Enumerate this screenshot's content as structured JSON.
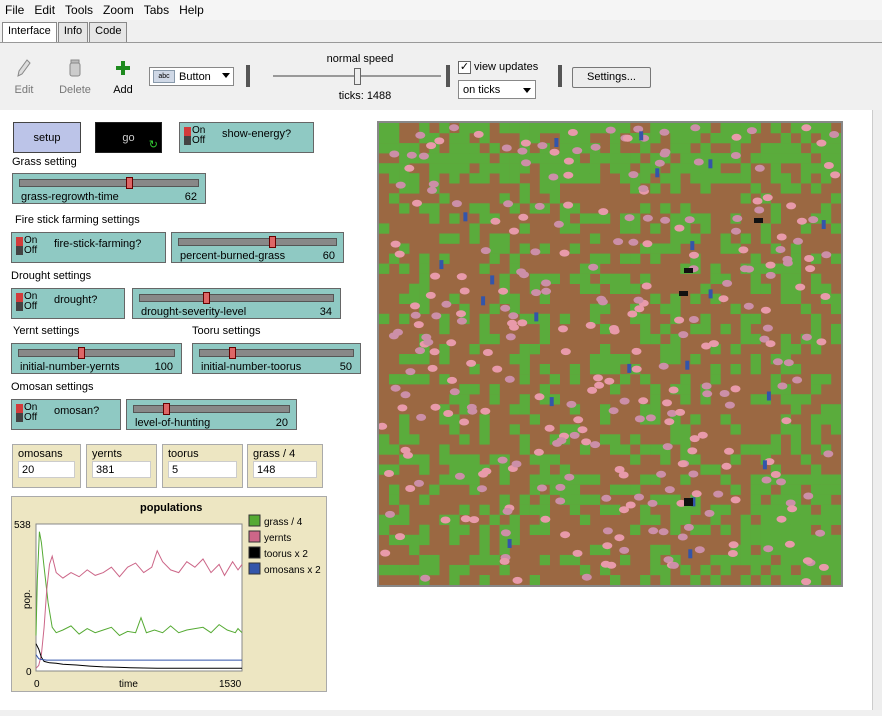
{
  "menu": [
    "File",
    "Edit",
    "Tools",
    "Zoom",
    "Tabs",
    "Help"
  ],
  "tabs": [
    {
      "label": "Interface",
      "active": true
    },
    {
      "label": "Info",
      "active": false
    },
    {
      "label": "Code",
      "active": false
    }
  ],
  "toolbar": {
    "edit_label": "Edit",
    "delete_label": "Delete",
    "add_label": "Add",
    "widget_type": "Button",
    "speed_label": "normal speed",
    "speed_fraction": 0.5,
    "ticks_text": "ticks: 1488",
    "view_updates_label": "view updates",
    "view_updates_checked": true,
    "update_mode": "on ticks",
    "settings_label": "Settings..."
  },
  "buttons": {
    "setup": "setup",
    "go": "go"
  },
  "switches": {
    "show_energy": {
      "name": "show-energy?",
      "on": "On",
      "off": "Off"
    },
    "fire_stick": {
      "name": "fire-stick-farming?",
      "on": "On",
      "off": "Off"
    },
    "drought": {
      "name": "drought?",
      "on": "On",
      "off": "Off"
    },
    "omosan": {
      "name": "omosan?",
      "on": "On",
      "off": "Off"
    }
  },
  "labels": {
    "grass": "Grass setting",
    "fire": "Fire stick farming settings",
    "drought": "Drought settings",
    "yernt": "Yernt settings",
    "tooru": "Tooru settings",
    "omosan": "Omosan settings"
  },
  "sliders": {
    "grass_regrowth": {
      "name": "grass-regrowth-time",
      "value": "62",
      "fraction": 0.62
    },
    "percent_burned": {
      "name": "percent-burned-grass",
      "value": "60",
      "fraction": 0.6
    },
    "drought_severity": {
      "name": "drought-severity-level",
      "value": "34",
      "fraction": 0.34
    },
    "initial_yernts": {
      "name": "initial-number-yernts",
      "value": "100",
      "fraction": 0.4
    },
    "initial_toorus": {
      "name": "initial-number-toorus",
      "value": "50",
      "fraction": 0.2
    },
    "level_hunting": {
      "name": "level-of-hunting",
      "value": "20",
      "fraction": 0.2
    }
  },
  "monitors": [
    {
      "name": "omosans",
      "value": "20"
    },
    {
      "name": "yernts",
      "value": "381"
    },
    {
      "name": "toorus",
      "value": "5"
    },
    {
      "name": "grass / 4",
      "value": "148"
    }
  ],
  "chart_data": {
    "type": "line",
    "title": "populations",
    "xlabel": "time",
    "ylabel": "pop.",
    "xlim": [
      0,
      1530
    ],
    "ylim": [
      0,
      538
    ],
    "x_tick_labels": [
      "0",
      "1530"
    ],
    "y_tick_labels": [
      "0",
      "538"
    ],
    "legend_position": "right",
    "series": [
      {
        "name": "grass / 4",
        "color": "#55aa33",
        "points": [
          [
            0,
            130
          ],
          [
            10,
            330
          ],
          [
            25,
            510
          ],
          [
            40,
            470
          ],
          [
            60,
            380
          ],
          [
            90,
            250
          ],
          [
            120,
            160
          ],
          [
            150,
            140
          ],
          [
            200,
            150
          ],
          [
            260,
            165
          ],
          [
            320,
            135
          ],
          [
            380,
            155
          ],
          [
            440,
            140
          ],
          [
            500,
            150
          ],
          [
            560,
            160
          ],
          [
            620,
            130
          ],
          [
            680,
            145
          ],
          [
            740,
            140
          ],
          [
            780,
            195
          ],
          [
            820,
            140
          ],
          [
            880,
            150
          ],
          [
            940,
            140
          ],
          [
            1000,
            165
          ],
          [
            1060,
            140
          ],
          [
            1120,
            150
          ],
          [
            1180,
            155
          ],
          [
            1240,
            160
          ],
          [
            1300,
            140
          ],
          [
            1360,
            170
          ],
          [
            1420,
            150
          ],
          [
            1480,
            140
          ],
          [
            1500,
            155
          ],
          [
            1530,
            140
          ]
        ]
      },
      {
        "name": "yernts",
        "color": "#cc6688",
        "points": [
          [
            0,
            10
          ],
          [
            20,
            20
          ],
          [
            40,
            60
          ],
          [
            60,
            160
          ],
          [
            80,
            300
          ],
          [
            100,
            390
          ],
          [
            120,
            420
          ],
          [
            150,
            360
          ],
          [
            200,
            340
          ],
          [
            260,
            360
          ],
          [
            320,
            345
          ],
          [
            380,
            370
          ],
          [
            440,
            350
          ],
          [
            500,
            360
          ],
          [
            560,
            380
          ],
          [
            620,
            345
          ],
          [
            680,
            380
          ],
          [
            740,
            395
          ],
          [
            800,
            360
          ],
          [
            860,
            380
          ],
          [
            900,
            440
          ],
          [
            940,
            400
          ],
          [
            1000,
            370
          ],
          [
            1060,
            360
          ],
          [
            1120,
            400
          ],
          [
            1180,
            380
          ],
          [
            1240,
            410
          ],
          [
            1300,
            360
          ],
          [
            1360,
            390
          ],
          [
            1400,
            350
          ],
          [
            1460,
            400
          ],
          [
            1500,
            370
          ],
          [
            1530,
            390
          ]
        ]
      },
      {
        "name": "toorus x 2",
        "color": "#000000",
        "points": [
          [
            0,
            100
          ],
          [
            20,
            80
          ],
          [
            40,
            50
          ],
          [
            60,
            35
          ],
          [
            100,
            30
          ],
          [
            150,
            28
          ],
          [
            200,
            25
          ],
          [
            300,
            22
          ],
          [
            400,
            18
          ],
          [
            500,
            15
          ],
          [
            600,
            14
          ],
          [
            700,
            12
          ],
          [
            800,
            11
          ],
          [
            900,
            10
          ],
          [
            1000,
            10
          ],
          [
            1100,
            10
          ],
          [
            1200,
            10
          ],
          [
            1300,
            10
          ],
          [
            1400,
            10
          ],
          [
            1530,
            10
          ]
        ]
      },
      {
        "name": "omosans x 2",
        "color": "#3355aa",
        "points": [
          [
            0,
            60
          ],
          [
            20,
            45
          ],
          [
            40,
            42
          ],
          [
            80,
            40
          ],
          [
            150,
            40
          ],
          [
            300,
            40
          ],
          [
            500,
            40
          ],
          [
            800,
            40
          ],
          [
            1100,
            40
          ],
          [
            1300,
            40
          ],
          [
            1530,
            40
          ]
        ]
      }
    ]
  }
}
